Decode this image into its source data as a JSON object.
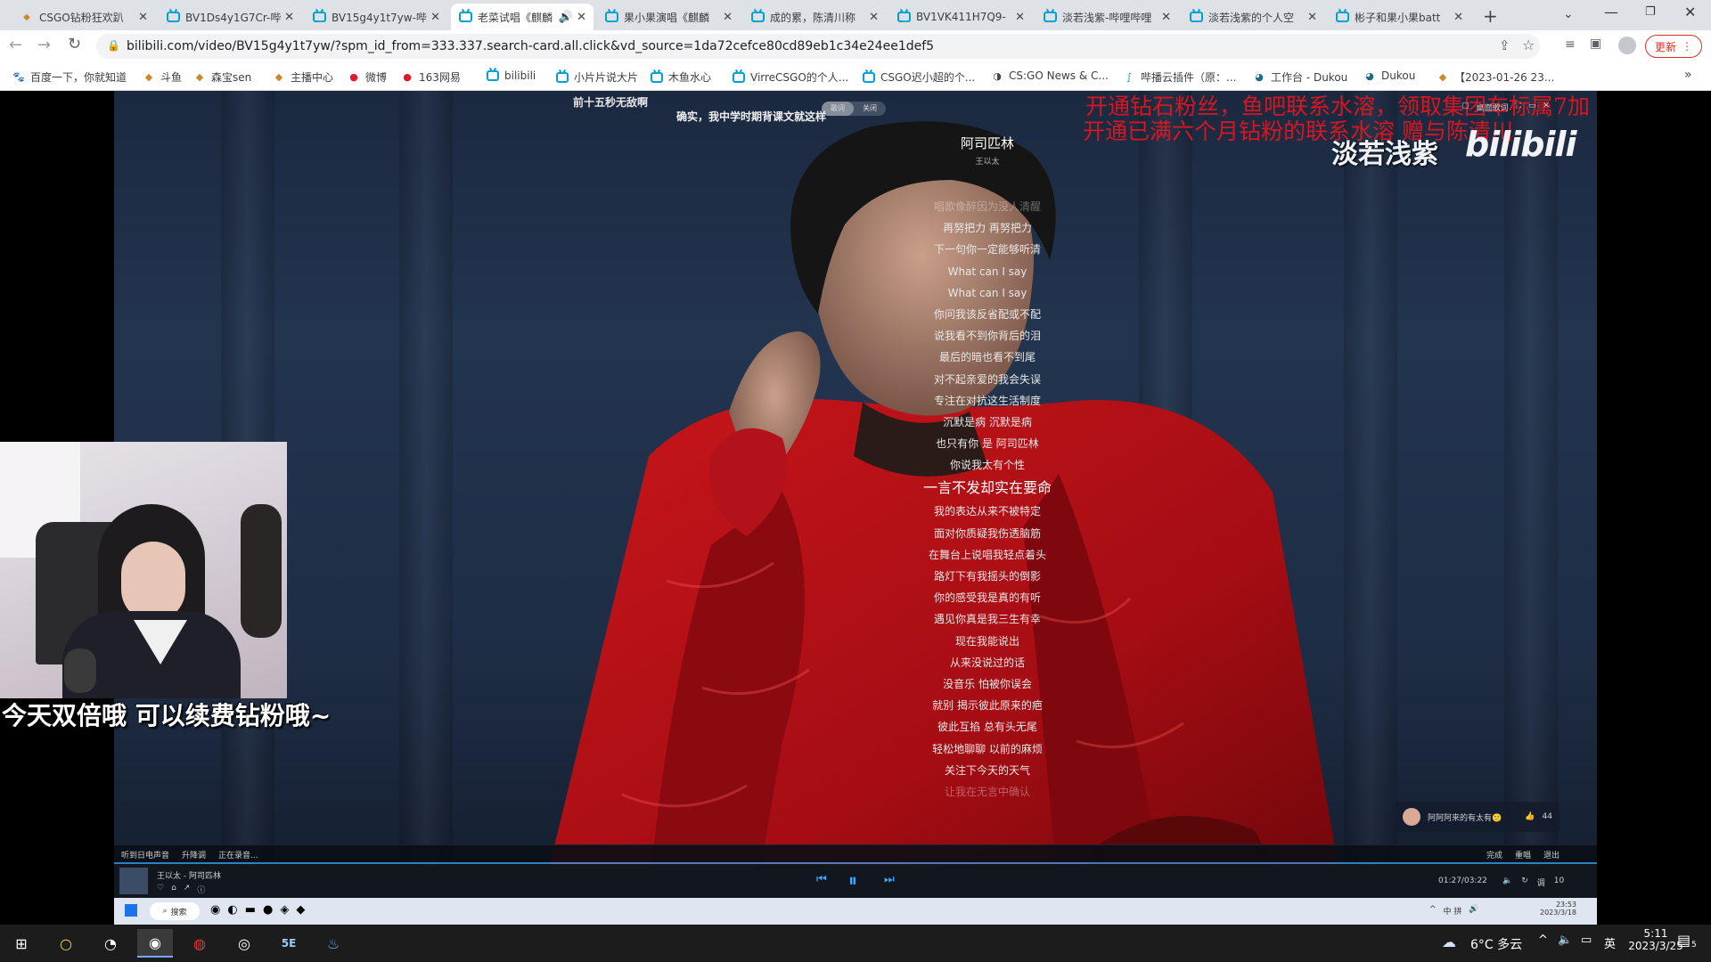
{
  "browser": {
    "tabs": [
      {
        "title": "CSGO钻粉狂欢趴",
        "icon": "csgo-icon"
      },
      {
        "title": "BV1Ds4y1G7Cr-哔",
        "icon": "bilibili-icon"
      },
      {
        "title": "BV15g4y1t7yw-哔",
        "icon": "bilibili-icon"
      },
      {
        "title": "老菜试唱《麒麟",
        "icon": "bilibili-icon",
        "active": true
      },
      {
        "title": "果小果演唱《麒麟",
        "icon": "bilibili-icon"
      },
      {
        "title": "成的累，陈清川称",
        "icon": "bilibili-icon"
      },
      {
        "title": "BV1VK411H7Q9-",
        "icon": "bilibili-icon"
      },
      {
        "title": "淡若浅紫-哔哩哔哩",
        "icon": "bilibili-icon"
      },
      {
        "title": "淡若浅紫的个人空",
        "icon": "bilibili-icon"
      },
      {
        "title": "彬子和果小果batt",
        "icon": "bilibili-icon"
      }
    ],
    "new_tab": "+",
    "url": "bilibili.com/video/BV15g4y1t7yw/?spm_id_from=333.337.search-card.all.click&vd_source=1da72cefce80cd89eb1c34e24ee1def5",
    "update_label": "更新",
    "bookmarks": [
      {
        "label": "百度一下，你就知道",
        "icon": "baidu-icon"
      },
      {
        "label": "斗鱼",
        "icon": "douyu-icon"
      },
      {
        "label": "森宝sen",
        "icon": "douyu-icon"
      },
      {
        "label": "主播中心",
        "icon": "douyu-icon"
      },
      {
        "label": "微博",
        "icon": "weibo-icon"
      },
      {
        "label": "163网易",
        "icon": "netease-icon"
      },
      {
        "label": "bilibili",
        "icon": "bilibili-icon"
      },
      {
        "label": "小片片说大片",
        "icon": "bilibili-icon"
      },
      {
        "label": "木鱼水心",
        "icon": "bilibili-icon"
      },
      {
        "label": "VirreCSGO的个人...",
        "icon": "bilibili-icon"
      },
      {
        "label": "CSGO迟小超的个...",
        "icon": "bilibili-icon"
      },
      {
        "label": "CS:GO News & C...",
        "icon": "hltv-icon"
      },
      {
        "label": "哔播云插件（原：...",
        "icon": "plugin-icon"
      },
      {
        "label": "工作台 - Dukou",
        "icon": "globe-icon"
      },
      {
        "label": "Dukou",
        "icon": "globe-icon"
      },
      {
        "label": "【2023-01-26 23...",
        "icon": "csgo-icon"
      }
    ],
    "bookmarks_more": "»"
  },
  "player": {
    "top_left_text": "前十五秒无敌啊",
    "top_comment": "确实，我中学时期背课文就这样",
    "song_title": "阿司匹林",
    "artist": "王以太",
    "lyrics": [
      {
        "text": "唱歌像醉因为没人清醒",
        "style": "dim"
      },
      {
        "text": "再努把力 再努把力"
      },
      {
        "text": "下一句你一定能够听清"
      },
      {
        "text": "What can I say"
      },
      {
        "text": "What can I say"
      },
      {
        "text": "你问我该反省配或不配"
      },
      {
        "text": "说我看不到你背后的泪"
      },
      {
        "text": "最后的暗也看不到尾"
      },
      {
        "text": "对不起亲爱的我会失误"
      },
      {
        "text": "专注在对抗这生活制度"
      },
      {
        "text": "沉默是病 沉默是病"
      },
      {
        "text": "也只有你 是 阿司匹林"
      },
      {
        "text": "你说我太有个性"
      },
      {
        "text": "一言不发却实在要命",
        "style": "big"
      },
      {
        "text": "我的表达从来不被特定"
      },
      {
        "text": "面对你质疑我伤透脑筋"
      },
      {
        "text": "在舞台上说唱我轻点着头"
      },
      {
        "text": "路灯下有我摇头的倒影"
      },
      {
        "text": "你的感受我是真的有听"
      },
      {
        "text": "遇见你真是我三生有幸"
      },
      {
        "text": "现在我能说出"
      },
      {
        "text": "从来没说过的话"
      },
      {
        "text": "没音乐 怕被你误会"
      },
      {
        "text": "就别 揭示彼此原来的疤"
      },
      {
        "text": "彼此互掐 总有头无尾"
      },
      {
        "text": "轻松地聊聊 以前的麻烦"
      },
      {
        "text": "关注下今天的天气"
      },
      {
        "text": "让我在无言中确认",
        "style": "dim"
      }
    ],
    "red_line_1": "开通钻石粉丝，鱼吧联系水溶，领取集团车标属7加",
    "red_line_2": "开通已满六个月钻粉的联系水溶 赠与陈清川",
    "streamer_name": "淡若浅紫",
    "logo_text": "bilibili",
    "webcam_caption": "今天双倍哦 可以续费钻粉哦~",
    "lyric_mode_toggle": [
      "歌词",
      "关闭"
    ],
    "top_right_controls": [
      "桌面歌词"
    ],
    "bottom_bar_left": [
      "听到日电声音",
      "升降调",
      "正在录音..."
    ],
    "bottom_bar_right": [
      "完成",
      "重唱",
      "退出"
    ],
    "now_playing": "王以太 - 阿司匹林",
    "time": "01:27/03:22",
    "player_right": [
      "调",
      "10"
    ],
    "comment_bubble": {
      "text": "阿阿阿来的有太有🙂",
      "count": "44"
    },
    "inner_taskbar": {
      "search": "搜索",
      "time": "23:53",
      "date": "2023/3/18",
      "ime": "中 拼"
    }
  },
  "taskbar": {
    "weather": "6°C 多云",
    "time": "5:11",
    "date": "2023/3/25",
    "notifications": "5",
    "ime": "英"
  }
}
